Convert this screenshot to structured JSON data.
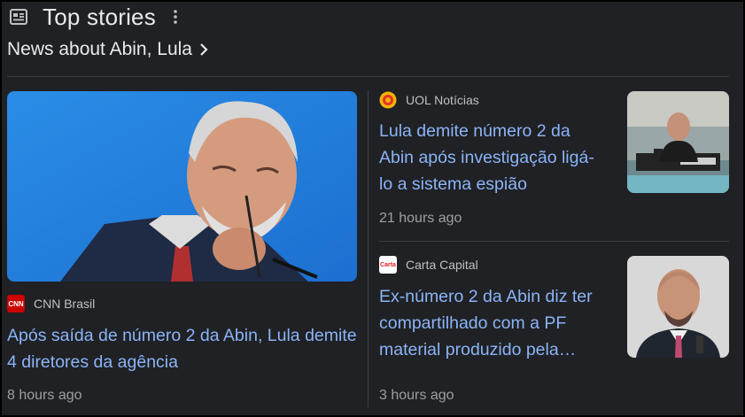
{
  "header": {
    "title": "Top stories",
    "news_icon": "newspaper-icon",
    "more_icon": "more-vert-icon"
  },
  "topic": {
    "label": "News about Abin, Lula",
    "icon": "chevron-right-icon"
  },
  "stories": [
    {
      "source": "CNN Brasil",
      "source_logo_text": "CNN",
      "logo_color": "#cc0000",
      "headline": "Após saída de número 2 da Abin, Lula demite 4 diretores da agência",
      "time": "8 hours ago"
    },
    {
      "source": "UOL Notícias",
      "logo_color": "#f5a623",
      "headline_lines": [
        "Lula demite número 2 da",
        "Abin após investigação ligá-",
        "lo a sistema espião"
      ],
      "time": "21 hours ago"
    },
    {
      "source": "Carta Capital",
      "source_logo_text": "Carta",
      "logo_color": "#e31b23",
      "headline_lines": [
        "Ex-número 2 da Abin diz ter",
        "compartilhado com a PF",
        "material produzido pela…"
      ],
      "time": "3 hours ago"
    }
  ],
  "colors": {
    "background": "#202124",
    "link": "#8ab4f8",
    "muted": "#9aa0a6"
  }
}
